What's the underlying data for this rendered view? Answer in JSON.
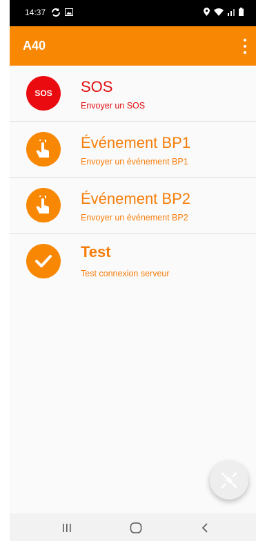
{
  "status_bar": {
    "time": "14:37"
  },
  "app_bar": {
    "title": "A40",
    "menu_icon": "more-vert-icon",
    "color": "#f88704"
  },
  "list": {
    "items": [
      {
        "title": "SOS",
        "subtitle": "Envoyer un SOS",
        "icon_text": "SOS",
        "icon": "sos-icon",
        "color": "#e10d0f"
      },
      {
        "title": "Événement BP1",
        "subtitle": "Envoyer un événement BP1",
        "icon": "touch-icon",
        "color": "#f57d0a"
      },
      {
        "title": "Événement BP2",
        "subtitle": "Envoyer un événement BP2",
        "icon": "touch-icon",
        "color": "#f57d0a"
      },
      {
        "title": "Test",
        "subtitle": "Test connexion serveur",
        "icon": "check-icon",
        "color": "#f57d0a"
      }
    ]
  },
  "fab": {
    "icon": "disconnected-plug-icon"
  },
  "nav_bar": {
    "recent_icon": "recent-apps-icon",
    "home_icon": "home-icon",
    "back_icon": "back-icon"
  }
}
